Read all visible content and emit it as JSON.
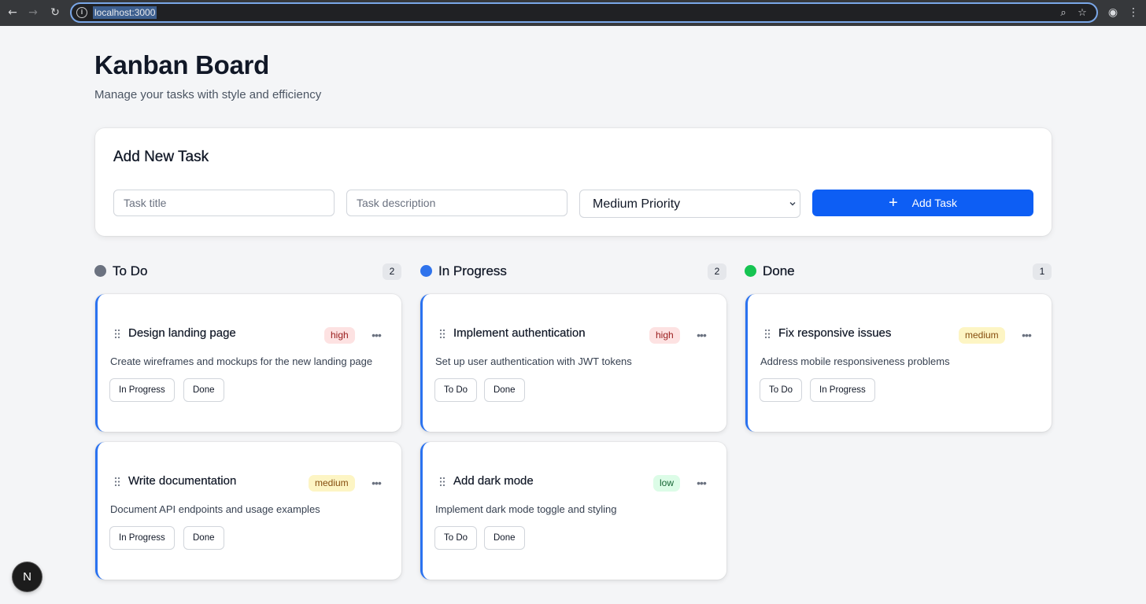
{
  "browser": {
    "url": "localhost:3000",
    "icons": {
      "back": "back-arrow-icon",
      "forward": "forward-arrow-icon",
      "reload": "reload-icon",
      "site_info": "info-icon",
      "zoom": "zoom-icon",
      "bookmark": "star-icon",
      "profile": "profile-icon",
      "menu": "kebab-menu-icon"
    }
  },
  "header": {
    "title": "Kanban Board",
    "subtitle": "Manage your tasks with style and efficiency"
  },
  "add_task": {
    "title": "Add New Task",
    "title_placeholder": "Task title",
    "description_placeholder": "Task description",
    "priority_selected": "Medium Priority",
    "button_label": "Add Task",
    "button_icon": "+"
  },
  "colors": {
    "todo_dot": "#6b7280",
    "in_progress_dot": "#2f73ec",
    "done_dot": "#16c452",
    "card_accent": "#2a72f0",
    "primary_button": "#0d5ef4"
  },
  "columns": [
    {
      "title": "To Do",
      "count": "2",
      "cards": [
        {
          "title": "Design landing page",
          "priority": "high",
          "description": "Create wireframes and mockups for the new landing page",
          "actions": [
            "In Progress",
            "Done"
          ]
        },
        {
          "title": "Write documentation",
          "priority": "medium",
          "description": "Document API endpoints and usage examples",
          "actions": [
            "In Progress",
            "Done"
          ]
        }
      ]
    },
    {
      "title": "In Progress",
      "count": "2",
      "cards": [
        {
          "title": "Implement authentication",
          "priority": "high",
          "description": "Set up user authentication with JWT tokens",
          "actions": [
            "To Do",
            "Done"
          ]
        },
        {
          "title": "Add dark mode",
          "priority": "low",
          "description": "Implement dark mode toggle and styling",
          "actions": [
            "To Do",
            "Done"
          ]
        }
      ]
    },
    {
      "title": "Done",
      "count": "1",
      "cards": [
        {
          "title": "Fix responsive issues",
          "priority": "medium",
          "description": "Address mobile responsiveness problems",
          "actions": [
            "To Do",
            "In Progress"
          ]
        }
      ]
    }
  ],
  "floating_badge": {
    "label": "N"
  }
}
